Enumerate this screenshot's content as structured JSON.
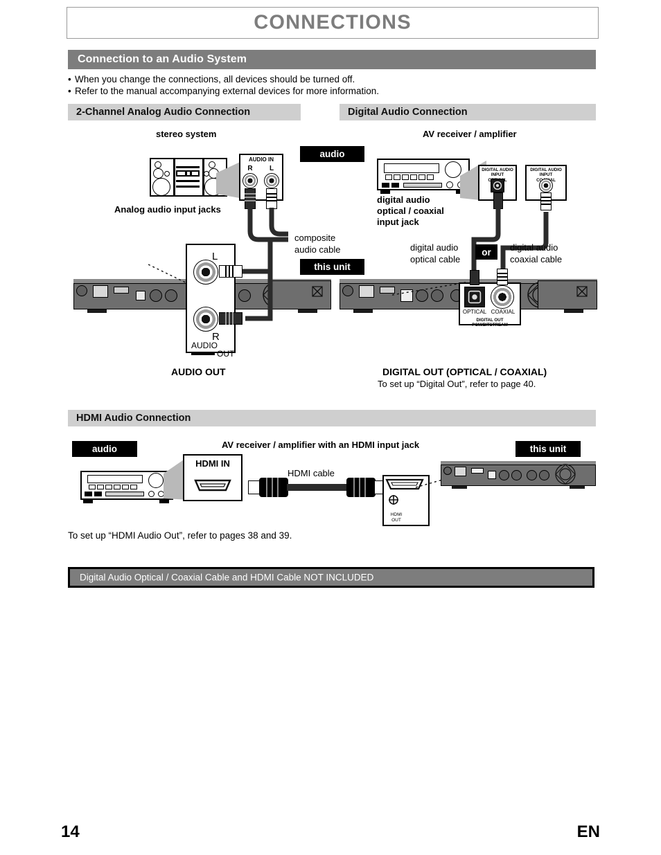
{
  "page": {
    "title": "CONNECTIONS",
    "number": "14",
    "language": "EN"
  },
  "section": {
    "heading": "Connection to an Audio System",
    "bullets": [
      "When you change the connections, all devices should be turned off.",
      "Refer to the manual accompanying external devices for more information."
    ]
  },
  "analog": {
    "heading": "2-Channel Analog Audio Connection",
    "device_label": "stereo system",
    "audio_tag": "audio",
    "jack_panel_title": "AUDIO IN",
    "jack_r": "R",
    "jack_l": "L",
    "input_jacks_caption": "Analog audio input jacks",
    "cable_label_line1": "composite",
    "cable_label_line2": "audio cable",
    "this_unit_tag": "this unit",
    "unit_jack_l": "L",
    "unit_jack_r": "R",
    "unit_panel_label": "AUDIO",
    "unit_panel_label2": "OUT",
    "caption": "AUDIO OUT"
  },
  "digital": {
    "heading": "Digital Audio Connection",
    "device_label": "AV receiver / amplifier",
    "input_jack_caption": [
      "digital audio",
      "optical / coaxial",
      "input jack"
    ],
    "optical_panel_line1": "DIGITAL AUDIO INPUT",
    "optical_panel_line2": "OPTICAL",
    "coaxial_panel_line1": "DIGITAL AUDIO INPUT",
    "coaxial_panel_line2": "COAXIAL",
    "optical_cable_line1": "digital audio",
    "optical_cable_line2": "optical cable",
    "or_tag": "or",
    "coaxial_cable_line1": "digital audio",
    "coaxial_cable_line2": "coaxial cable",
    "unit_optical_label": "OPTICAL",
    "unit_coaxial_label": "COAXIAL",
    "unit_panel_line1": "DIGITAL OUT",
    "unit_panel_line2": "PCM/BITSTREAM",
    "caption": "DIGITAL OUT (OPTICAL / COAXIAL)",
    "caption_note": "To set up “Digital Out”, refer to page 40."
  },
  "hdmi": {
    "heading": "HDMI Audio Connection",
    "audio_tag": "audio",
    "device_label": "AV receiver / amplifier with an HDMI input jack",
    "this_unit_tag": "this unit",
    "hdmi_in_label": "HDMI IN",
    "cable_label": "HDMI cable",
    "hdmi_out_line1": "HDMI",
    "hdmi_out_line2": "OUT",
    "note": "To set up  “HDMI Audio Out”, refer to pages 38 and 39."
  },
  "notice": "Digital Audio Optical / Coaxial Cable and HDMI Cable NOT INCLUDED",
  "colors": {
    "header_gray": "#7d7d7d",
    "subsection_gray": "#cfcfcf",
    "tag_black": "#000000",
    "chassis_gray": "#6e6e6e"
  }
}
